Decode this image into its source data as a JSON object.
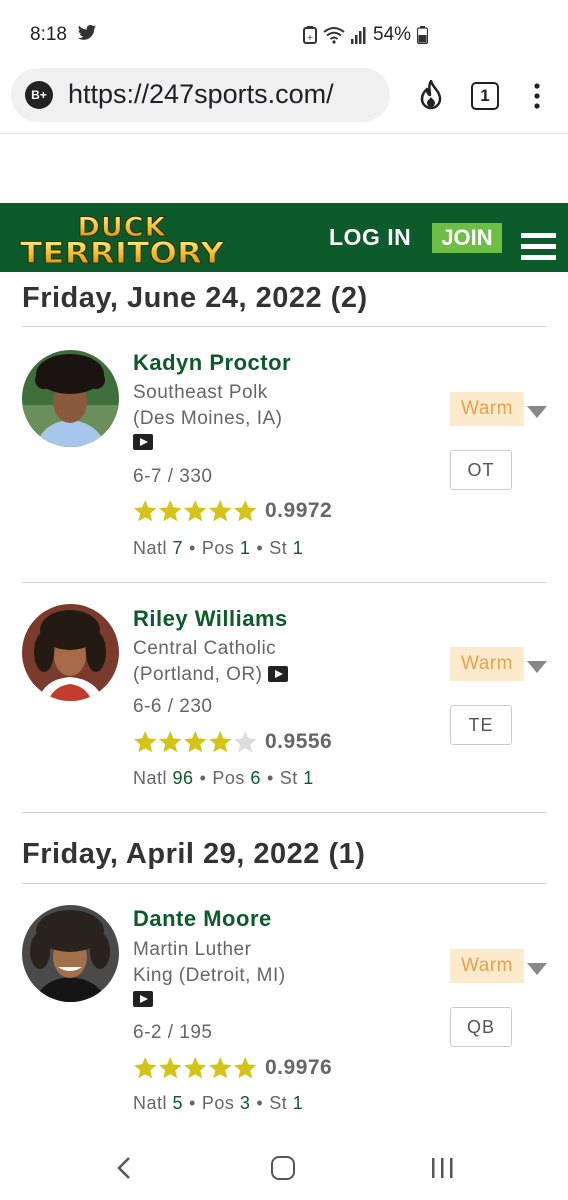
{
  "status_bar": {
    "time": "8:18",
    "battery": "54%",
    "icons": [
      "twitter-icon",
      "battery-saver-icon",
      "wifi-icon",
      "signal-icon",
      "battery-icon"
    ]
  },
  "browser": {
    "site_badge": "B+",
    "url": "https://247sports.com/",
    "tab_count": "1",
    "icons": [
      "flame-icon",
      "tabs-icon",
      "kebab-menu-icon"
    ]
  },
  "header": {
    "logo_line1": "DUCK",
    "logo_line2": "TERRITORY",
    "login_label": "LOG IN",
    "join_label": "JOIN",
    "colors": {
      "background": "#0d5a2a",
      "join": "#6dbe45",
      "logo_gold": "#f2c230"
    }
  },
  "sections": [
    {
      "heading": "Friday, June 24, 2022 (2)",
      "recruits": [
        {
          "name": "Kadyn Proctor",
          "school": "Southeast Polk",
          "hometown": "(Des Moines, IA)",
          "measurements": "6-7 / 330",
          "stars": 5,
          "rating": "0.9972",
          "natl_label": "Natl",
          "natl": "7",
          "pos_label": "Pos",
          "pos_rank": "1",
          "st_label": "St",
          "st": "1",
          "status": "Warm",
          "position": "OT"
        },
        {
          "name": "Riley Williams",
          "school": "Central Catholic",
          "hometown": "(Portland, OR)",
          "measurements": "6-6 / 230",
          "stars": 4,
          "rating": "0.9556",
          "natl_label": "Natl",
          "natl": "96",
          "pos_label": "Pos",
          "pos_rank": "6",
          "st_label": "St",
          "st": "1",
          "status": "Warm",
          "position": "TE"
        }
      ]
    },
    {
      "heading": "Friday, April 29, 2022 (1)",
      "recruits": [
        {
          "name": "Dante Moore",
          "school": "Martin Luther",
          "hometown": "King (Detroit, MI)",
          "measurements": "6-2 / 195",
          "stars": 5,
          "rating": "0.9976",
          "natl_label": "Natl",
          "natl": "5",
          "pos_label": "Pos",
          "pos_rank": "3",
          "st_label": "St",
          "st": "1",
          "status": "Warm",
          "position": "QB"
        }
      ]
    }
  ],
  "colors": {
    "name_green": "#0d5a2a",
    "star_gold": "#d4c41a",
    "star_empty": "#dddddd",
    "warm_bg": "#fde9cc",
    "warm_text": "#e8a24a"
  }
}
